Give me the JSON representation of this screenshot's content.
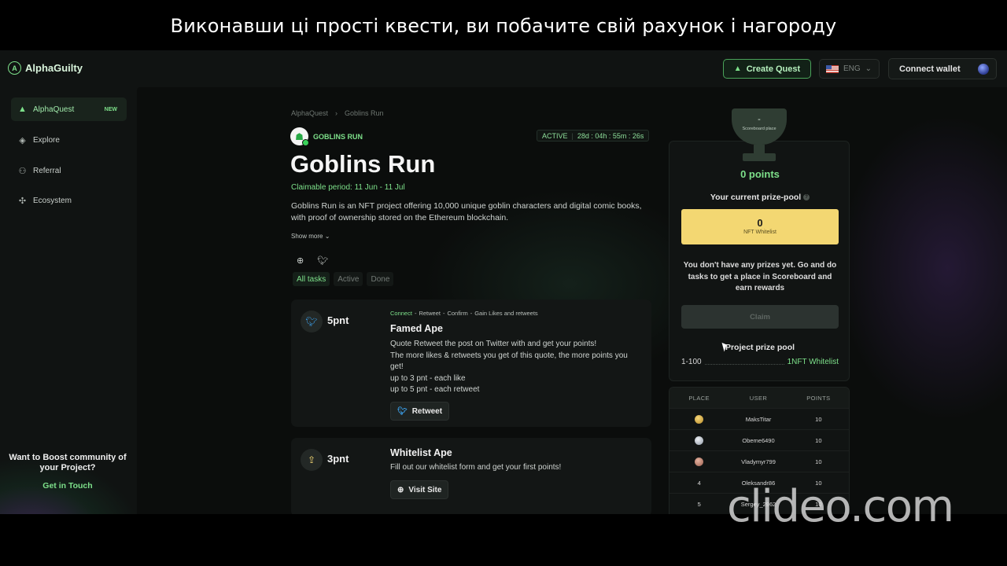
{
  "caption": "Виконавши ці прості квести, ви побачите свій рахунок і нагороду",
  "watermark": "clideo.com",
  "header": {
    "logo": "AlphaGuilty",
    "create_quest": "Create Quest",
    "lang": "ENG",
    "connect_wallet": "Connect wallet"
  },
  "sidebar": {
    "items": [
      {
        "label": "AlphaQuest",
        "badge": "NEW",
        "icon": "alpha-icon",
        "active": true
      },
      {
        "label": "Explore",
        "icon": "explore-icon"
      },
      {
        "label": "Referral",
        "icon": "referral-icon"
      },
      {
        "label": "Ecosystem",
        "icon": "ecosystem-icon"
      }
    ],
    "boost_title": "Want to Boost community of your Project?",
    "boost_link": "Get in Touch"
  },
  "breadcrumb": {
    "root": "AlphaQuest",
    "current": "Goblins Run"
  },
  "project": {
    "name": "GOBLINS RUN",
    "status": "ACTIVE",
    "countdown": "28d : 04h : 55m : 26s",
    "title": "Goblins Run",
    "period": "Claimable period: 11 Jun - 11 Jul",
    "description": "Goblins Run is an NFT project offering 10,000 unique goblin characters and digital comic books, with proof of ownership stored on the Ethereum blockchain.",
    "show_more": "Show more"
  },
  "tabs": [
    "All tasks",
    "Active",
    "Done"
  ],
  "tasks": [
    {
      "points": "5pnt",
      "steps": [
        "Connect",
        "Retweet",
        "Confirm",
        "Gain Likes and retweets"
      ],
      "title": "Famed Ape",
      "text": [
        "Quote Retweet the post on Twitter with and get your points!",
        "The more likes & retweets you get of this quote, the more points you get!",
        "up to 3 pnt - each like",
        "up to 5 pnt - each retweet"
      ],
      "button": "Retweet"
    },
    {
      "points": "3pnt",
      "title": "Whitelist Ape",
      "text": [
        "Fill out our whitelist form and get your first points!"
      ],
      "button": "Visit Site"
    }
  ],
  "prize": {
    "trophy_value": "-",
    "trophy_label": "Scoreboard place",
    "points": "0 points",
    "pool_label": "Your current prize-pool",
    "pool_value": "0",
    "pool_type": "NFT Whitelist",
    "no_prizes": "You don't have any prizes yet. Go and do tasks to get a place in Scoreboard and earn rewards",
    "claim": "Claim",
    "project_pool_label": "Project prize pool",
    "range": "1-100",
    "reward": "1NFT Whitelist"
  },
  "scoreboard": {
    "headers": [
      "PLACE",
      "USER",
      "POINTS"
    ],
    "rows": [
      {
        "place": "",
        "medal": "gold",
        "user": "MaksTitar",
        "points": "10"
      },
      {
        "place": "",
        "medal": "silver",
        "user": "Obeme6490",
        "points": "10"
      },
      {
        "place": "",
        "medal": "bronze",
        "user": "Vladymyr799",
        "points": "10"
      },
      {
        "place": "4",
        "user": "Oleksandr86",
        "points": "10"
      },
      {
        "place": "5",
        "user": "Sergey_2962",
        "points": "10"
      }
    ]
  }
}
